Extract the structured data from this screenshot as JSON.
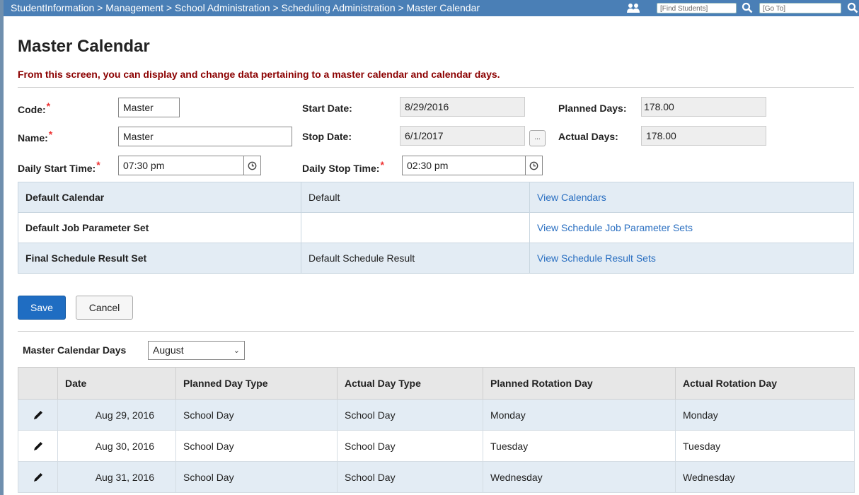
{
  "topbar": {
    "breadcrumb": "StudentInformation > Management > School Administration > Scheduling Administration > Master Calendar",
    "find_students_placeholder": "[Find Students]",
    "go_to_placeholder": "[Go To]"
  },
  "page": {
    "title": "Master Calendar",
    "description": "From this screen, you can display and change data pertaining to a master calendar and calendar days."
  },
  "form": {
    "code_label": "Code:",
    "code_value": "Master",
    "name_label": "Name:",
    "name_value": "Master",
    "start_time_label": "Daily Start Time:",
    "start_time_value": "07:30 pm",
    "start_date_label": "Start Date:",
    "start_date_value": "8/29/2016",
    "stop_date_label": "Stop Date:",
    "stop_date_value": "6/1/2017",
    "stop_time_label": "Daily Stop Time:",
    "stop_time_value": "02:30 pm",
    "planned_days_label": "Planned Days:",
    "planned_days_value": "178.00",
    "actual_days_label": "Actual Days:",
    "actual_days_value": "178.00",
    "ellipsis_label": "..."
  },
  "info": [
    {
      "key": "Default Calendar",
      "value": "Default",
      "link": "View Calendars"
    },
    {
      "key": "Default Job Parameter Set",
      "value": "",
      "link": "View Schedule Job Parameter Sets"
    },
    {
      "key": "Final Schedule Result Set",
      "value": "Default Schedule Result",
      "link": "View Schedule Result Sets"
    }
  ],
  "buttons": {
    "save": "Save",
    "cancel": "Cancel"
  },
  "days": {
    "label": "Master Calendar Days",
    "month": "August",
    "columns": [
      "Date",
      "Planned Day Type",
      "Actual Day Type",
      "Planned Rotation Day",
      "Actual Rotation Day"
    ],
    "rows": [
      [
        "Aug 29, 2016",
        "School Day",
        "School Day",
        "Monday",
        "Monday"
      ],
      [
        "Aug 30, 2016",
        "School Day",
        "School Day",
        "Tuesday",
        "Tuesday"
      ],
      [
        "Aug 31, 2016",
        "School Day",
        "School Day",
        "Wednesday",
        "Wednesday"
      ]
    ]
  },
  "colors": {
    "topbar": "#4a7fb6",
    "accent": "#1f6dc2",
    "description": "#8b0000",
    "link": "#2a6fc1"
  },
  "icons": [
    "users-icon",
    "search-icon",
    "clock-icon",
    "pencil-icon",
    "chevron-down-icon"
  ]
}
